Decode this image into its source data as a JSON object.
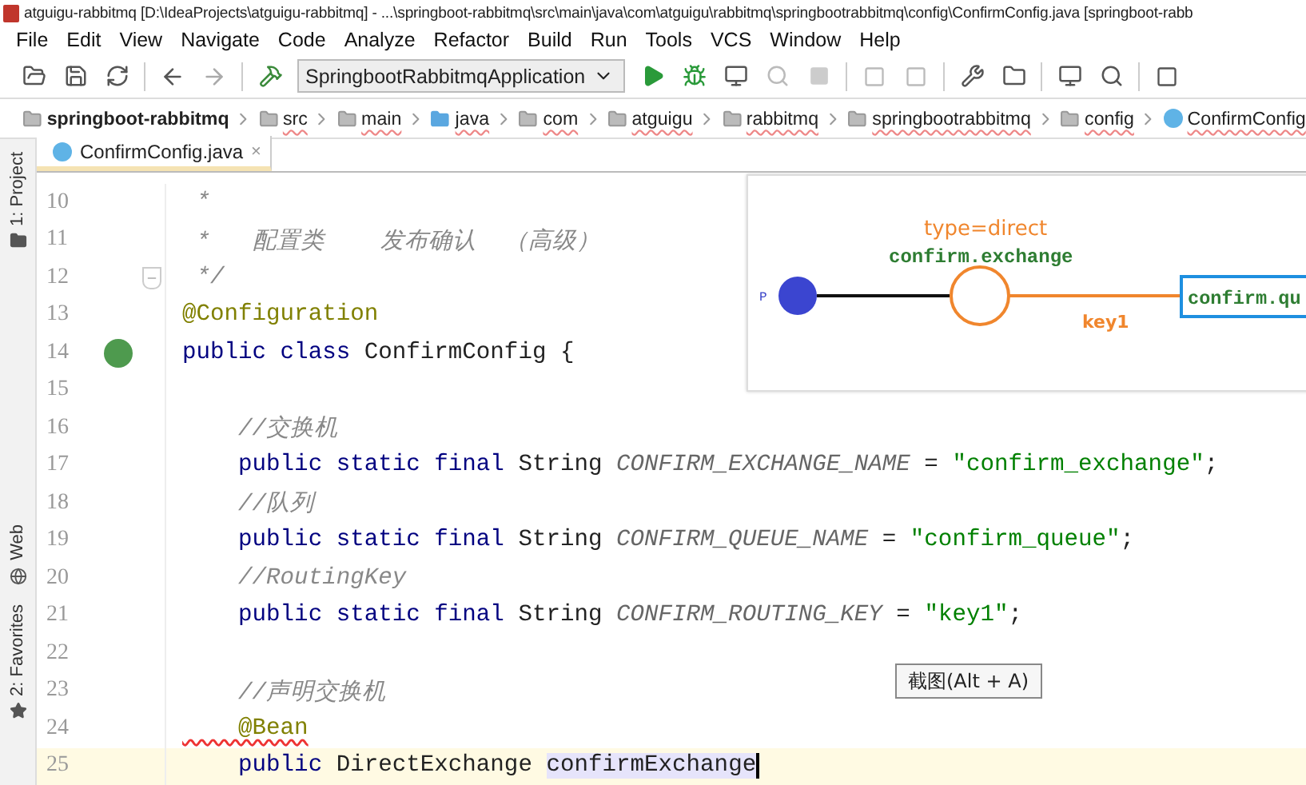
{
  "window": {
    "title": "atguigu-rabbitmq [D:\\IdeaProjects\\atguigu-rabbitmq] - ...\\springboot-rabbitmq\\src\\main\\java\\com\\atguigu\\rabbitmq\\springbootrabbitmq\\config\\ConfirmConfig.java [springboot-rabb"
  },
  "menu": [
    "File",
    "Edit",
    "View",
    "Navigate",
    "Code",
    "Analyze",
    "Refactor",
    "Build",
    "Run",
    "Tools",
    "VCS",
    "Window",
    "Help"
  ],
  "toolbar": {
    "run_config": "SpringbootRabbitmqApplication"
  },
  "breadcrumbs": [
    {
      "label": "springboot-rabbitmq",
      "kind": "module"
    },
    {
      "label": "src",
      "kind": "folder"
    },
    {
      "label": "main",
      "kind": "folder"
    },
    {
      "label": "java",
      "kind": "source"
    },
    {
      "label": "com",
      "kind": "folder"
    },
    {
      "label": "atguigu",
      "kind": "folder"
    },
    {
      "label": "rabbitmq",
      "kind": "folder"
    },
    {
      "label": "springbootrabbitmq",
      "kind": "folder"
    },
    {
      "label": "config",
      "kind": "folder"
    },
    {
      "label": "ConfirmConfig",
      "kind": "class"
    }
  ],
  "tabs": [
    {
      "label": "ConfirmConfig.java",
      "close": "×",
      "selected": true
    }
  ],
  "side_panels": [
    {
      "label": "1: Project",
      "kind": "project"
    },
    {
      "label": "Web",
      "kind": "web"
    },
    {
      "label": "2: Favorites",
      "kind": "favorites"
    }
  ],
  "editor": {
    "lines": [
      {
        "number": "10",
        "tokens": [
          {
            "kind": "comment",
            "text": " *"
          }
        ]
      },
      {
        "number": "11",
        "tokens": [
          {
            "kind": "comment",
            "text": " *   配置类    发布确认  （高级）"
          }
        ]
      },
      {
        "number": "12",
        "kind": "fold",
        "tokens": [
          {
            "kind": "comment",
            "text": " */"
          }
        ]
      },
      {
        "number": "13",
        "tokens": [
          {
            "kind": "annotation",
            "text": "@Configuration"
          }
        ]
      },
      {
        "number": "14",
        "kind": "bean",
        "tokens": [
          {
            "kind": "keyword",
            "text": "public class "
          },
          {
            "kind": "plain",
            "text": "ConfirmConfig {"
          }
        ]
      },
      {
        "number": "15"
      },
      {
        "number": "16",
        "tokens": [
          {
            "kind": "comment",
            "text": "    //交换机"
          }
        ]
      },
      {
        "number": "17",
        "tokens": [
          {
            "kind": "keyword",
            "text": "    public static final "
          },
          {
            "kind": "plain",
            "text": "String "
          },
          {
            "kind": "constant",
            "text": "CONFIRM_EXCHANGE_NAME"
          },
          {
            "kind": "plain",
            "text": " = "
          },
          {
            "kind": "string",
            "text": "\"confirm_exchange\""
          },
          {
            "kind": "plain",
            "text": ";"
          }
        ]
      },
      {
        "number": "18",
        "tokens": [
          {
            "kind": "comment",
            "text": "    //队列"
          }
        ]
      },
      {
        "number": "19",
        "tokens": [
          {
            "kind": "keyword",
            "text": "    public static final "
          },
          {
            "kind": "plain",
            "text": "String "
          },
          {
            "kind": "constant",
            "text": "CONFIRM_QUEUE_NAME"
          },
          {
            "kind": "plain",
            "text": " = "
          },
          {
            "kind": "string",
            "text": "\"confirm_queue\""
          },
          {
            "kind": "plain",
            "text": ";"
          }
        ]
      },
      {
        "number": "20",
        "tokens": [
          {
            "kind": "comment",
            "text": "    //RoutingKey"
          }
        ]
      },
      {
        "number": "21",
        "tokens": [
          {
            "kind": "keyword",
            "text": "    public static final "
          },
          {
            "kind": "plain",
            "text": "String "
          },
          {
            "kind": "constant",
            "text": "CONFIRM_ROUTING_KEY"
          },
          {
            "kind": "plain",
            "text": " = "
          },
          {
            "kind": "string",
            "text": "\"key1\""
          },
          {
            "kind": "plain",
            "text": ";"
          }
        ]
      },
      {
        "number": "22"
      },
      {
        "number": "23",
        "tokens": [
          {
            "kind": "comment",
            "text": "    //声明交换机"
          }
        ]
      },
      {
        "number": "24",
        "tokens": [
          {
            "kind": "error_annotation",
            "text": "    @Bean"
          }
        ]
      },
      {
        "number": "25",
        "current": true,
        "tokens": [
          {
            "kind": "keyword",
            "text": "    public "
          },
          {
            "kind": "plain",
            "text": "DirectExchange "
          },
          {
            "kind": "selected",
            "text": "confirmExchange"
          }
        ]
      }
    ]
  },
  "diagram": {
    "producer": "P",
    "exchange_type": "type=direct",
    "exchange": "confirm.exchange",
    "routing_key": "key1",
    "queue": "confirm.qu"
  },
  "tooltip": "截图(Alt + A)"
}
